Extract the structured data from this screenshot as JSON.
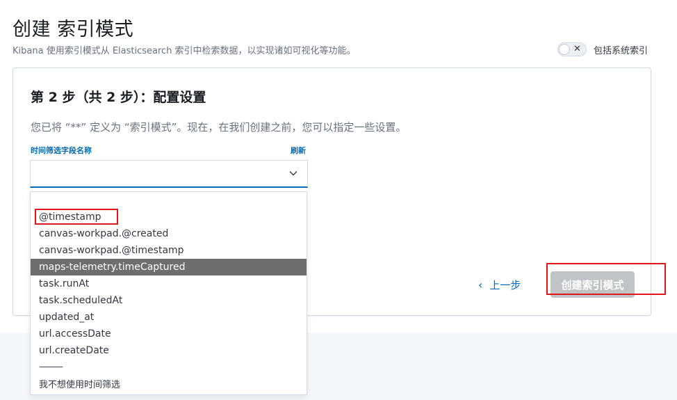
{
  "header": {
    "title": "创建 索引模式",
    "subtitle": "Kibana 使用索引模式从 Elasticsearch 索引中检索数据，以实现诸如可视化等功能。",
    "toggle_label": "包括系统索引",
    "toggle_on": false
  },
  "step": {
    "title": "第 2 步（共 2 步）：配置设置",
    "description": "您已将 “**” 定义为 “索引模式”。现在，在我们创建之前，您可以指定一些设置。"
  },
  "time_field": {
    "label": "时间筛选字段名称",
    "refresh_label": "刷新",
    "selected_value": "",
    "options": [
      "@timestamp",
      "canvas-workpad.@created",
      "canvas-workpad.@timestamp",
      "maps-telemetry.timeCaptured",
      "task.runAt",
      "task.scheduledAt",
      "updated_at",
      "url.accessDate",
      "url.createDate",
      "———",
      "我不想使用时间筛选"
    ],
    "highlighted_option": "maps-telemetry.timeCaptured"
  },
  "actions": {
    "back_label": "上一步",
    "create_label": "创建索引模式"
  },
  "colors": {
    "accent": "#006bb4",
    "annotation": "#e0161b",
    "disabled_button": "#c2c3c6",
    "highlight_row": "#6e6e6e"
  }
}
